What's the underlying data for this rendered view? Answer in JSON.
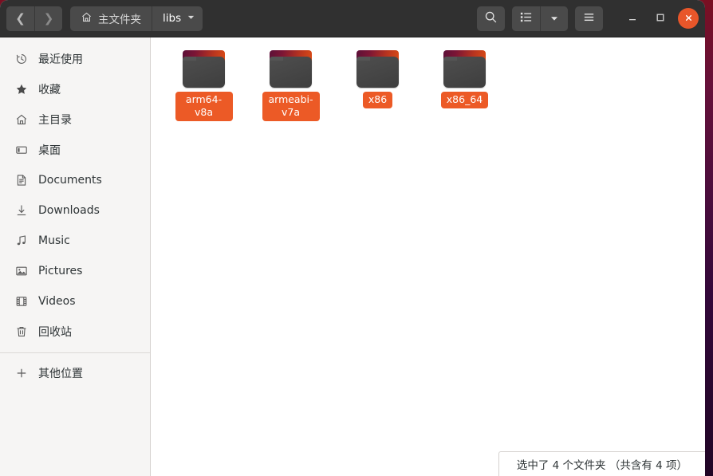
{
  "window": {
    "title": "libs",
    "close_glyph": "✕",
    "minimize_glyph": "—",
    "maximize_glyph": "▫"
  },
  "header": {
    "back_glyph": "❮",
    "forward_glyph": "❯",
    "home_label": "主文件夹",
    "current_label": "libs",
    "dropdown_glyph": "▼",
    "search_tooltip": "搜索",
    "view_tooltip": "查看方式",
    "menu_tooltip": "主菜单"
  },
  "sidebar": {
    "items": [
      {
        "label": "最近使用",
        "icon": "clock-icon"
      },
      {
        "label": "收藏",
        "icon": "star-icon"
      },
      {
        "label": "主目录",
        "icon": "home-icon"
      },
      {
        "label": "桌面",
        "icon": "desktop-icon"
      },
      {
        "label": "Documents",
        "icon": "documents-icon"
      },
      {
        "label": "Downloads",
        "icon": "downloads-icon"
      },
      {
        "label": "Music",
        "icon": "music-icon"
      },
      {
        "label": "Pictures",
        "icon": "pictures-icon"
      },
      {
        "label": "Videos",
        "icon": "videos-icon"
      },
      {
        "label": "回收站",
        "icon": "trash-icon"
      }
    ],
    "other_locations": {
      "label": "其他位置",
      "icon": "plus-icon"
    }
  },
  "files": [
    {
      "name": "arm64-v8a",
      "type": "folder"
    },
    {
      "name": "armeabi-v7a",
      "type": "folder"
    },
    {
      "name": "x86",
      "type": "folder"
    },
    {
      "name": "x86_64",
      "type": "folder"
    }
  ],
  "status": {
    "text": "选中了 4 个文件夹 （共含有 4 项）"
  },
  "colors": {
    "accent": "#ec5a26",
    "close_button": "#e8562a",
    "headerbar": "#303030",
    "sidebar": "#f6f5f4"
  }
}
